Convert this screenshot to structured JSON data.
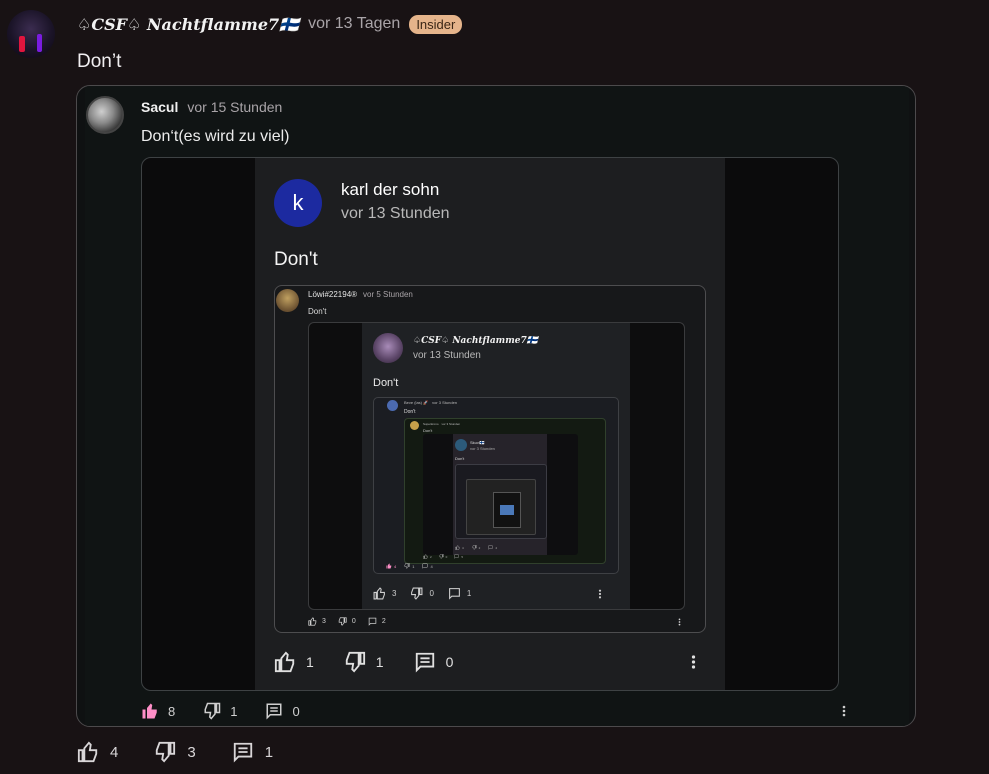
{
  "thread": [
    {
      "author": "♤CSF♤ 𝑵𝒂𝒄𝒉𝒕𝒇𝒍𝒂𝒎𝒎𝒆7🇫🇮",
      "time": "vor 13 Tagen",
      "badge": "Insider",
      "text": "Don’t",
      "likes": "4",
      "dislikes": "3",
      "replies": "1"
    },
    {
      "author": "Sacul",
      "time": "vor 15 Stunden",
      "text": "Don‘t(es wird zu viel)",
      "likes": "8",
      "dislikes": "1",
      "replies": "0"
    },
    {
      "avatar_letter": "k",
      "author": "karl der sohn",
      "time": "vor 13 Stunden",
      "text": "Don't",
      "likes": "1",
      "dislikes": "1",
      "replies": "0"
    },
    {
      "author": "Löwi#22194®",
      "time": "vor 5 Stunden",
      "text": "Don't",
      "likes": "3",
      "dislikes": "0",
      "replies": "2"
    },
    {
      "author": "♤CSF♤ 𝑵𝒂𝒄𝒉𝒕𝒇𝒍𝒂𝒎𝒎𝒆7🇫🇮",
      "time": "vor 13 Stunden",
      "text": "Don't",
      "likes": "3",
      "dislikes": "0",
      "replies": "1"
    },
    {
      "author": "Beve (las) 🚀",
      "time": "vor 3 Stunden",
      "text": "Don't",
      "likes": "4",
      "dislikes": "1",
      "replies": "4"
    },
    {
      "author": "Superkrono",
      "time": "vor 3 Stunden",
      "text": "Don't",
      "likes": "2",
      "dislikes": "0",
      "replies": "5"
    },
    {
      "author": "Skuvi🇫🇮",
      "time": "vor 3 Stunden",
      "text": "Don't",
      "likes": "4",
      "dislikes": "2",
      "replies": "4"
    }
  ],
  "colors": {
    "background": "#181214",
    "liked_accent": "#ff8fc8",
    "badge": "#e5b48b",
    "avatar_k": "#1c2aa0"
  },
  "icons": [
    "thumbs-up-icon",
    "thumbs-down-icon",
    "comment-icon",
    "more-vertical-icon"
  ]
}
